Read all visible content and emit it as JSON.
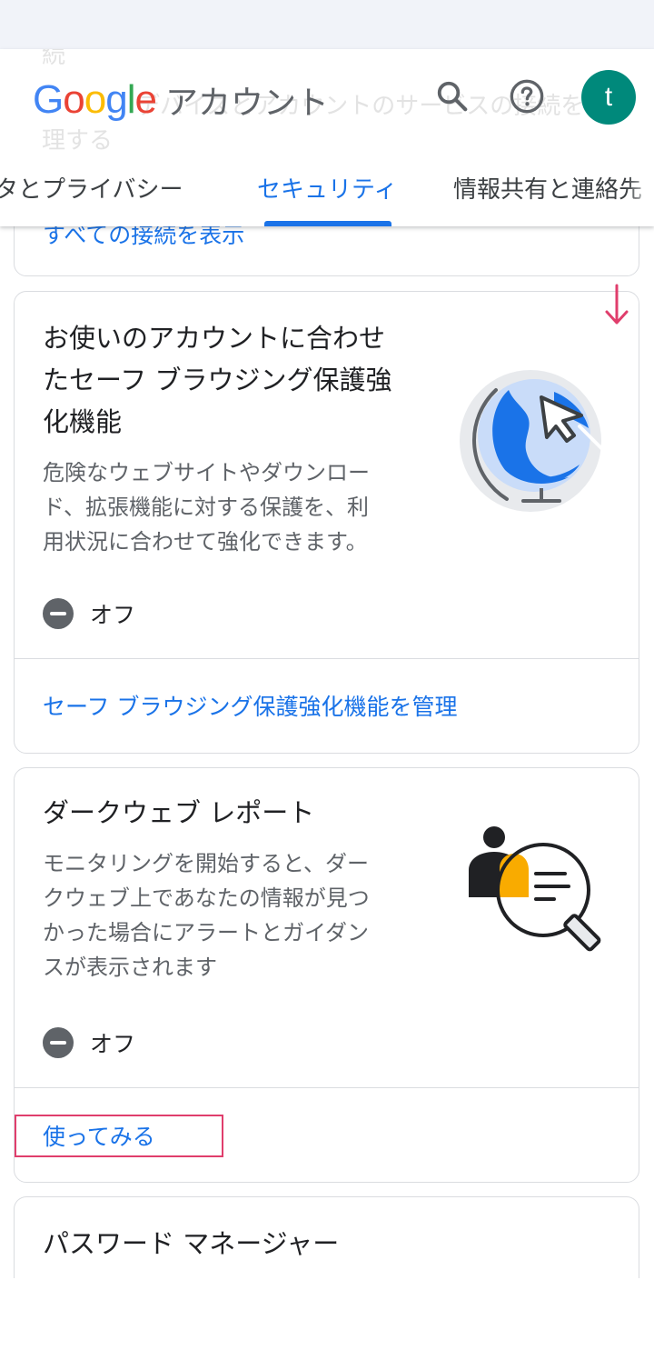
{
  "header": {
    "logo_letters": [
      "G",
      "o",
      "o",
      "g",
      "l",
      "e"
    ],
    "logo_colors": [
      "#4285F4",
      "#EA4335",
      "#FBBC05",
      "#4285F4",
      "#34A853",
      "#EA4335"
    ],
    "app_title": "アカウント",
    "avatar_letter": "t",
    "avatar_color": "#00897b",
    "icons": {
      "search": "search-icon",
      "help": "help-icon"
    },
    "ghost_text": [
      "続",
      "デバイスとアカウントのサービスの接続を管",
      "理する"
    ]
  },
  "tabs": [
    {
      "label": "データとプライバシー",
      "active": false
    },
    {
      "label": "セキュリティ",
      "active": true
    },
    {
      "label": "情報共有と連絡先",
      "active": false
    }
  ],
  "top_card": {
    "link": "すべての接続を表示"
  },
  "cards": {
    "safe_browsing": {
      "title_lines": [
        "お使いのアカウントに合わせ",
        "たセーフ ブラウジング保護強",
        "化機能"
      ],
      "desc_lines": [
        "危険なウェブサイトやダウンロー",
        "ド、拡張機能に対する保護を、利",
        "用状況に合わせて強化できます。"
      ],
      "status": "オフ",
      "link": "セーフ ブラウジング保護強化機能を管理",
      "illustration": "globe-cursor-illustration"
    },
    "dark_web": {
      "title": "ダークウェブ レポート",
      "desc_lines": [
        "モニタリングを開始すると、ダー",
        "クウェブ上であなたの情報が見つ",
        "かった場合にアラートとガイダン",
        "スが表示されます"
      ],
      "status": "オフ",
      "link": "使ってみる",
      "illustration": "magnifier-person-illustration"
    },
    "password_manager": {
      "title": "パスワード マネージャー"
    }
  },
  "annotations": {
    "highlight_color": "#e03e6c",
    "arrow": "down-arrow-icon"
  }
}
